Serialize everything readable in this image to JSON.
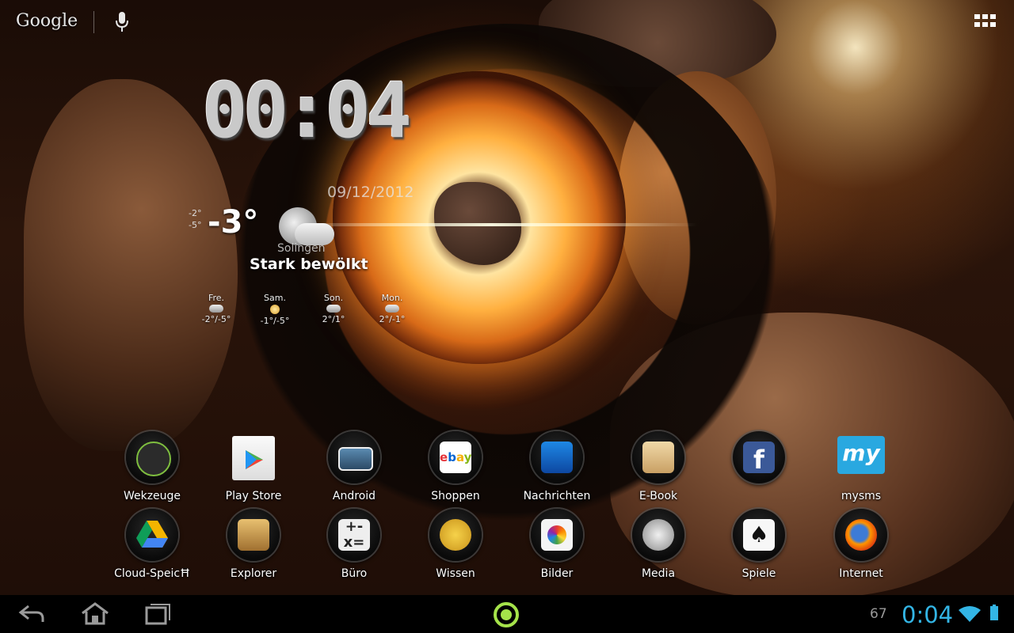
{
  "top_bar": {
    "search_label": "Google",
    "icons": [
      "google-search-icon",
      "mic-icon",
      "all-apps-icon"
    ]
  },
  "clock_widget": {
    "time": "00:04",
    "date": "09/12/2012"
  },
  "weather_widget": {
    "high": "-2°",
    "low": "-5°",
    "current_temp": "-3°",
    "city": "Solingen",
    "condition": "Stark bewölkt",
    "forecast": [
      {
        "day": "Fre.",
        "temps": "-2°/-5°",
        "icon": "cloud-icon"
      },
      {
        "day": "Sam.",
        "temps": "-1°/-5°",
        "icon": "sun-cloud-icon"
      },
      {
        "day": "Son.",
        "temps": "2°/1°",
        "icon": "cloud-icon"
      },
      {
        "day": "Mon.",
        "temps": "2°/-1°",
        "icon": "cloud-icon"
      }
    ]
  },
  "apps": {
    "row1": [
      {
        "label": "Wekzeuge",
        "icon": "tools-folder-icon"
      },
      {
        "label": "Play Store",
        "icon": "play-store-icon"
      },
      {
        "label": "Android",
        "icon": "android-folder-icon"
      },
      {
        "label": "Shoppen",
        "icon": "ebay-folder-icon"
      },
      {
        "label": "Nachrichten",
        "icon": "news-folder-icon"
      },
      {
        "label": "E-Book",
        "icon": "kindle-folder-icon"
      },
      {
        "label": "",
        "icon": "facebook-folder-icon"
      },
      {
        "label": "mysms",
        "icon": "mysms-icon"
      }
    ],
    "row2": [
      {
        "label": "Cloud-SpeicĦ",
        "icon": "drive-folder-icon"
      },
      {
        "label": "Explorer",
        "icon": "file-explorer-icon"
      },
      {
        "label": "Büro",
        "icon": "office-folder-icon"
      },
      {
        "label": "Wissen",
        "icon": "wikipedia-folder-icon"
      },
      {
        "label": "Bilder",
        "icon": "gallery-folder-icon"
      },
      {
        "label": "Media",
        "icon": "media-folder-icon"
      },
      {
        "label": "Spiele",
        "icon": "games-folder-icon"
      },
      {
        "label": "Internet",
        "icon": "firefox-folder-icon"
      }
    ]
  },
  "nav_bar": {
    "notification_count": "67",
    "time": "0:04",
    "buttons": [
      "back-icon",
      "home-icon",
      "recent-apps-icon",
      "launcher-icon"
    ],
    "status_icons": [
      "wifi-icon",
      "battery-icon"
    ]
  },
  "colors": {
    "status_time": "#33b5e5",
    "launcher_ring": "#a5e34a"
  }
}
